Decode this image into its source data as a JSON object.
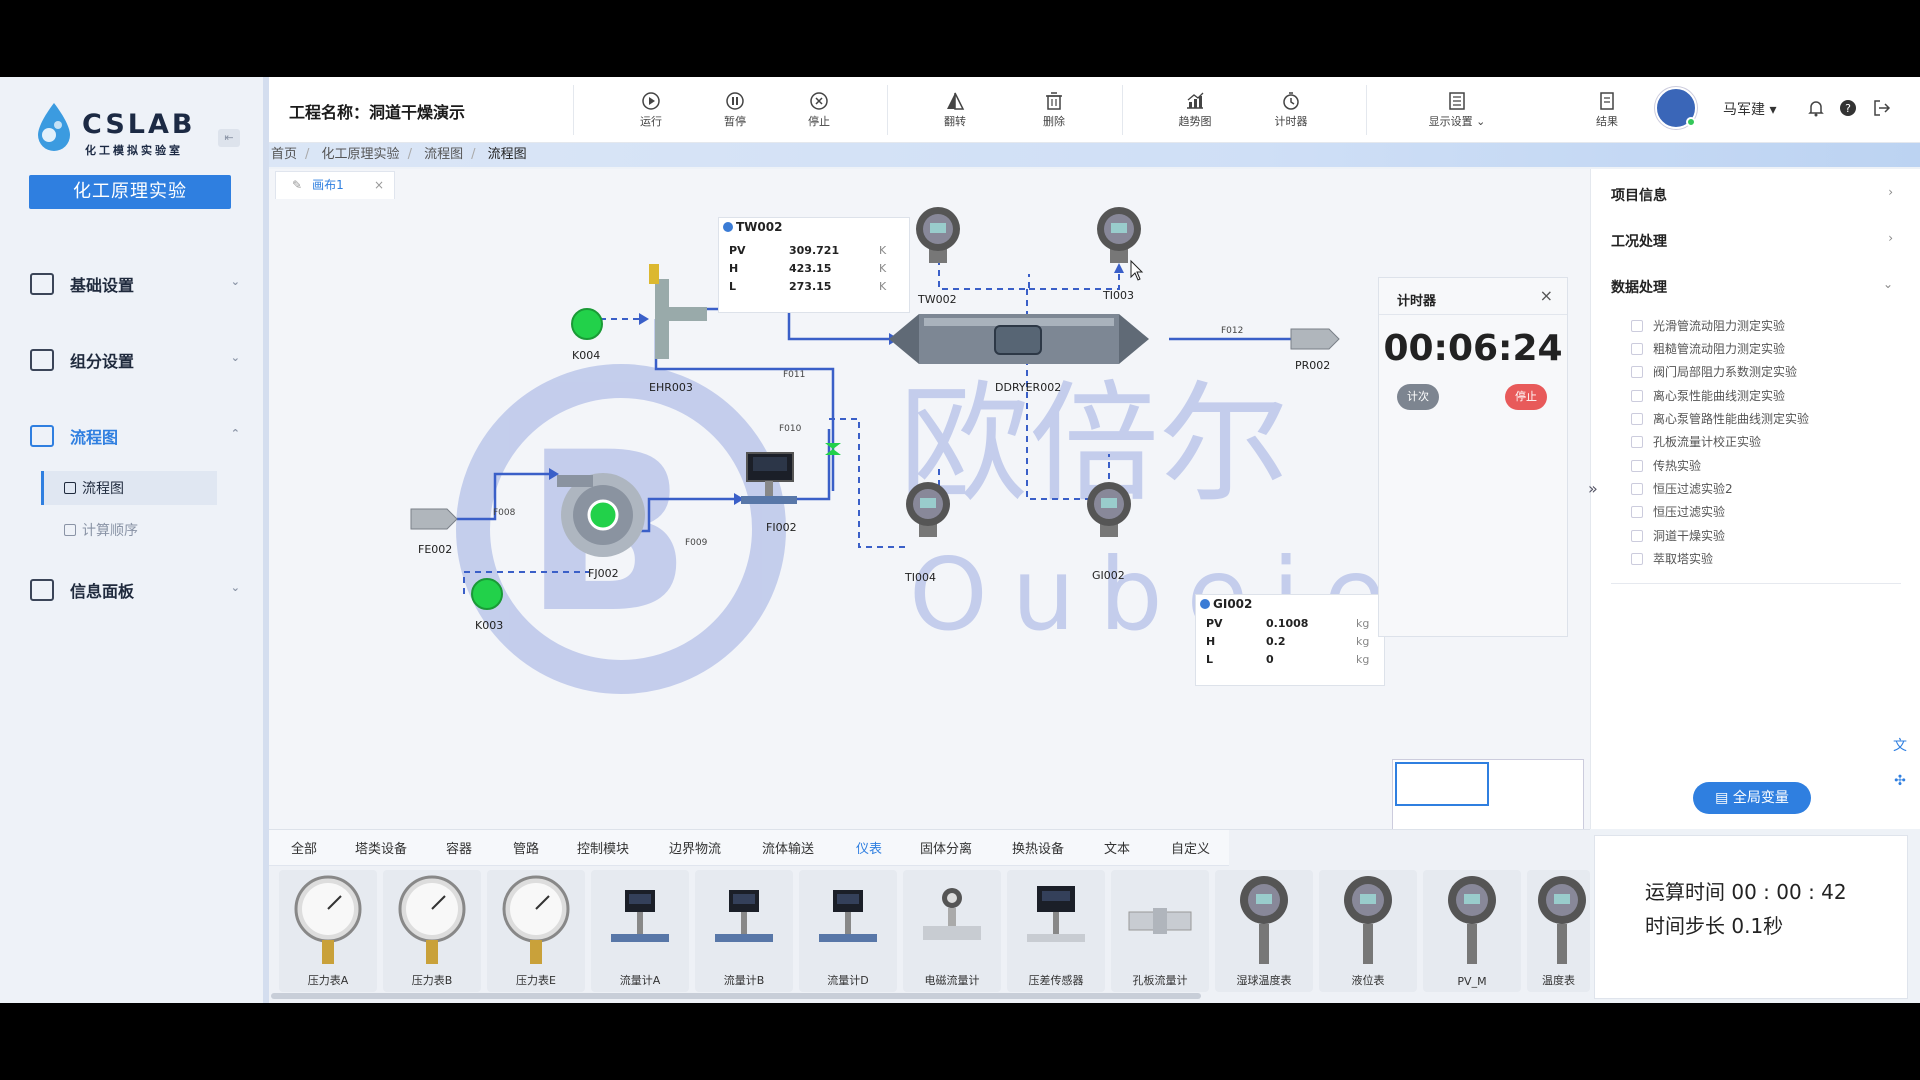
{
  "app": {
    "logo_text": "CSLAB",
    "logo_sub": "化工模拟实验室",
    "project_button": "化工原理实验"
  },
  "sidebar": {
    "menu": [
      {
        "label": "基础设置",
        "icon": "person-icon"
      },
      {
        "label": "组分设置",
        "icon": "component-icon"
      },
      {
        "label": "流程图",
        "icon": "flowchart-icon"
      },
      {
        "label": "信息面板",
        "icon": "panel-icon"
      }
    ],
    "submenu": [
      {
        "label": "流程图",
        "active": true
      },
      {
        "label": "计算顺序",
        "active": false
      }
    ]
  },
  "header": {
    "project_title": "工程名称：洞道干燥演示",
    "toolbar": [
      {
        "label": "运行",
        "icon": "play-icon"
      },
      {
        "label": "暂停",
        "icon": "pause-icon"
      },
      {
        "label": "停止",
        "icon": "stop-icon"
      },
      {
        "label": "翻转",
        "icon": "flip-icon"
      },
      {
        "label": "删除",
        "icon": "trash-icon"
      },
      {
        "label": "趋势图",
        "icon": "trend-icon"
      },
      {
        "label": "计时器",
        "icon": "timer-icon"
      },
      {
        "label": "显示设置",
        "icon": "display-settings-icon"
      },
      {
        "label": "结果",
        "icon": "result-icon"
      }
    ],
    "user_name": "马军建"
  },
  "breadcrumb": [
    "首页",
    "化工原理实验",
    "流程图",
    "流程图"
  ],
  "canvas": {
    "tab_label": "画布1"
  },
  "flowsheet": {
    "equipment": [
      {
        "id": "TW002"
      },
      {
        "id": "TI003"
      },
      {
        "id": "EHR003"
      },
      {
        "id": "K004"
      },
      {
        "id": "DDRYER002"
      },
      {
        "id": "PR002"
      },
      {
        "id": "TI004"
      },
      {
        "id": "GI002"
      },
      {
        "id": "FI002"
      },
      {
        "id": "FJ002"
      },
      {
        "id": "FE002"
      },
      {
        "id": "K003"
      }
    ],
    "streams": [
      "F011",
      "F012",
      "F010",
      "F008",
      "F009"
    ],
    "watermark_text": "Oubeier",
    "watermark_cn": "欧倍尔"
  },
  "cards": {
    "tw002": {
      "title": "TW002",
      "rows": [
        {
          "k": "PV",
          "v": "309.721",
          "u": "K"
        },
        {
          "k": "H",
          "v": "423.15",
          "u": "K"
        },
        {
          "k": "L",
          "v": "273.15",
          "u": "K"
        }
      ]
    },
    "gi002": {
      "title": "GI002",
      "rows": [
        {
          "k": "PV",
          "v": "0.1008",
          "u": "kg"
        },
        {
          "k": "H",
          "v": "0.2",
          "u": "kg"
        },
        {
          "k": "L",
          "v": "0",
          "u": "kg"
        }
      ]
    }
  },
  "timer": {
    "title": "计时器",
    "value": "00:06:24",
    "btn_count": "计次",
    "btn_stop": "停止"
  },
  "right_panel": {
    "sections": [
      "项目信息",
      "工况处理",
      "数据处理"
    ],
    "experiments": [
      "光滑管流动阻力测定实验",
      "粗糙管流动阻力测定实验",
      "阀门局部阻力系数测定实验",
      "离心泵性能曲线测定实验",
      "离心泵管路性能曲线测定实验",
      "孔板流量计校正实验",
      "传热实验",
      "恒压过滤实验2",
      "恒压过滤实验",
      "洞道干燥实验",
      "萃取塔实验"
    ],
    "global_vars_button": "全局变量"
  },
  "palette": {
    "tabs": [
      "全部",
      "塔类设备",
      "容器",
      "管路",
      "控制模块",
      "边界物流",
      "流体输送",
      "仪表",
      "固体分离",
      "换热设备",
      "文本",
      "自定义"
    ],
    "active_tab": "仪表",
    "items": [
      "压力表A",
      "压力表B",
      "压力表E",
      "流量计A",
      "流量计B",
      "流量计D",
      "电磁流量计",
      "压差传感器",
      "孔板流量计",
      "湿球温度表",
      "液位表",
      "PV_M",
      "温度表"
    ]
  },
  "runtime": {
    "time_label": "运算时间 00 : 00 : 42",
    "step_label": "时间步长 0.1秒"
  },
  "colors": {
    "accent": "#2f7fe0",
    "pipe": "#3a5fc8",
    "status_green": "#22d14a",
    "stop_red": "#e85a5a"
  }
}
